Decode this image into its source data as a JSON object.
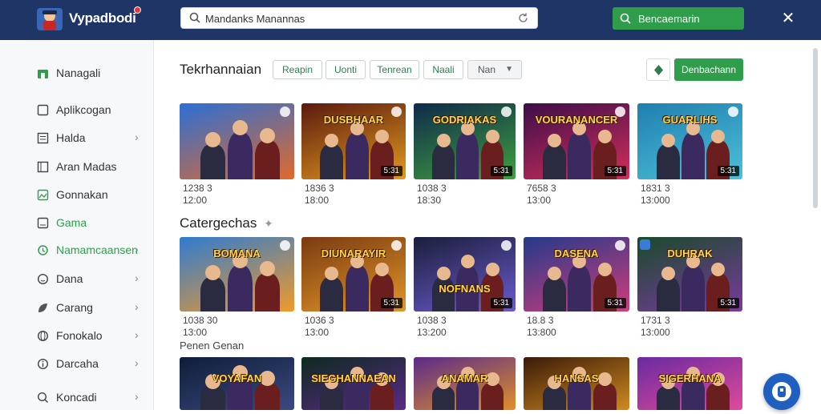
{
  "header": {
    "app_name": "Vypadbodi",
    "search": {
      "value": "Mandanks Manannas"
    },
    "action_button_label": "Bencaemarin"
  },
  "sidebar": {
    "items": [
      {
        "label": "Nanagali",
        "icon": "home-icon",
        "active": true
      },
      {
        "label": "Aplikcogan",
        "icon": "square-icon"
      },
      {
        "label": "Halda",
        "icon": "list-icon",
        "chevron": true
      },
      {
        "label": "Aran Madas",
        "icon": "book-icon"
      },
      {
        "label": "Gonnakan",
        "icon": "image-icon"
      },
      {
        "label": "Gama",
        "icon": "gamepad-icon",
        "green": true
      },
      {
        "label": "Namamcaansen",
        "icon": "refresh-icon",
        "green": true,
        "chevron": true
      },
      {
        "label": "Dana",
        "icon": "smile-icon",
        "chevron": true
      },
      {
        "label": "Carang",
        "icon": "leaf-icon",
        "chevron": true
      },
      {
        "label": "Fonokalo",
        "icon": "globe-icon",
        "chevron": true
      },
      {
        "label": "Darcaha",
        "icon": "info-icon",
        "chevron": true
      },
      {
        "label": "Koncadi",
        "icon": "search-icon",
        "chevron": true
      }
    ]
  },
  "main": {
    "section1_title": "Tekrhannaian",
    "filters": [
      "Reapin",
      "Uonti",
      "Tenrean",
      "Naali"
    ],
    "filter_select": "Nan",
    "right_button_label": "Denbachann",
    "section2_title": "Catergechas",
    "section3_title": "Penen Genan",
    "row1": [
      {
        "title": "",
        "duration": "",
        "meta1": "1238 3",
        "meta2": "12:00",
        "colors": [
          "#2b6fd6",
          "#e06a2b"
        ]
      },
      {
        "title": "DUSBHAAR",
        "duration": "5:31",
        "meta1": "1836 3",
        "meta2": "18:00",
        "colors": [
          "#5a1a0e",
          "#e39a1f"
        ]
      },
      {
        "title": "GODRIAKAS",
        "duration": "5:31",
        "meta1": "1038 3",
        "meta2": "18:30",
        "colors": [
          "#0f2a4a",
          "#3fa040"
        ]
      },
      {
        "title": "VOURANANCER",
        "duration": "5:31",
        "meta1": "7658 3",
        "meta2": "13:00",
        "colors": [
          "#3d0d4a",
          "#d22f5a"
        ]
      },
      {
        "title": "GUARLIHS",
        "duration": "5:31",
        "meta1": "1831 3",
        "meta2": "13:000",
        "colors": [
          "#1f7fb0",
          "#4ec0d8"
        ]
      }
    ],
    "row2": [
      {
        "title": "BOMANA",
        "duration": "",
        "meta1": "1038 30",
        "meta2": "13:00",
        "colors": [
          "#2f7bd0",
          "#f09a2a"
        ]
      },
      {
        "title": "DIUNARAYIR",
        "duration": "5:31",
        "meta1": "1036 3",
        "meta2": "13:00",
        "colors": [
          "#7a3a10",
          "#e2962a"
        ]
      },
      {
        "title": "NOFNANS",
        "duration": "5:31",
        "meta1": "1038 3",
        "meta2": "13:200",
        "colors": [
          "#1a1e3a",
          "#6c5bd0"
        ]
      },
      {
        "title": "DASENA",
        "duration": "5:31",
        "meta1": "18.8 3",
        "meta2": "13:800",
        "colors": [
          "#243a8a",
          "#d23c7a"
        ]
      },
      {
        "title": "DUHRAK",
        "duration": "5:31",
        "meta1": "1731 3",
        "meta2": "13:000",
        "colors": [
          "#1a4a2a",
          "#7a3aa0"
        ]
      }
    ],
    "row3": [
      {
        "title": "VOYAFAN",
        "colors": [
          "#0f1d3a",
          "#3a4a80"
        ]
      },
      {
        "title": "SIEGHANNAEAN",
        "colors": [
          "#0d2a1e",
          "#5a2a8a"
        ]
      },
      {
        "title": "ANAMAR",
        "colors": [
          "#5a2a8a",
          "#e0902a"
        ]
      },
      {
        "title": "HANSAS",
        "colors": [
          "#3a1a08",
          "#d08a20"
        ]
      },
      {
        "title": "SIGERHANA",
        "colors": [
          "#6a2aa0",
          "#e04a9a"
        ]
      }
    ]
  },
  "accent_green": "#2e9e4b",
  "header_bg": "#1e3566"
}
